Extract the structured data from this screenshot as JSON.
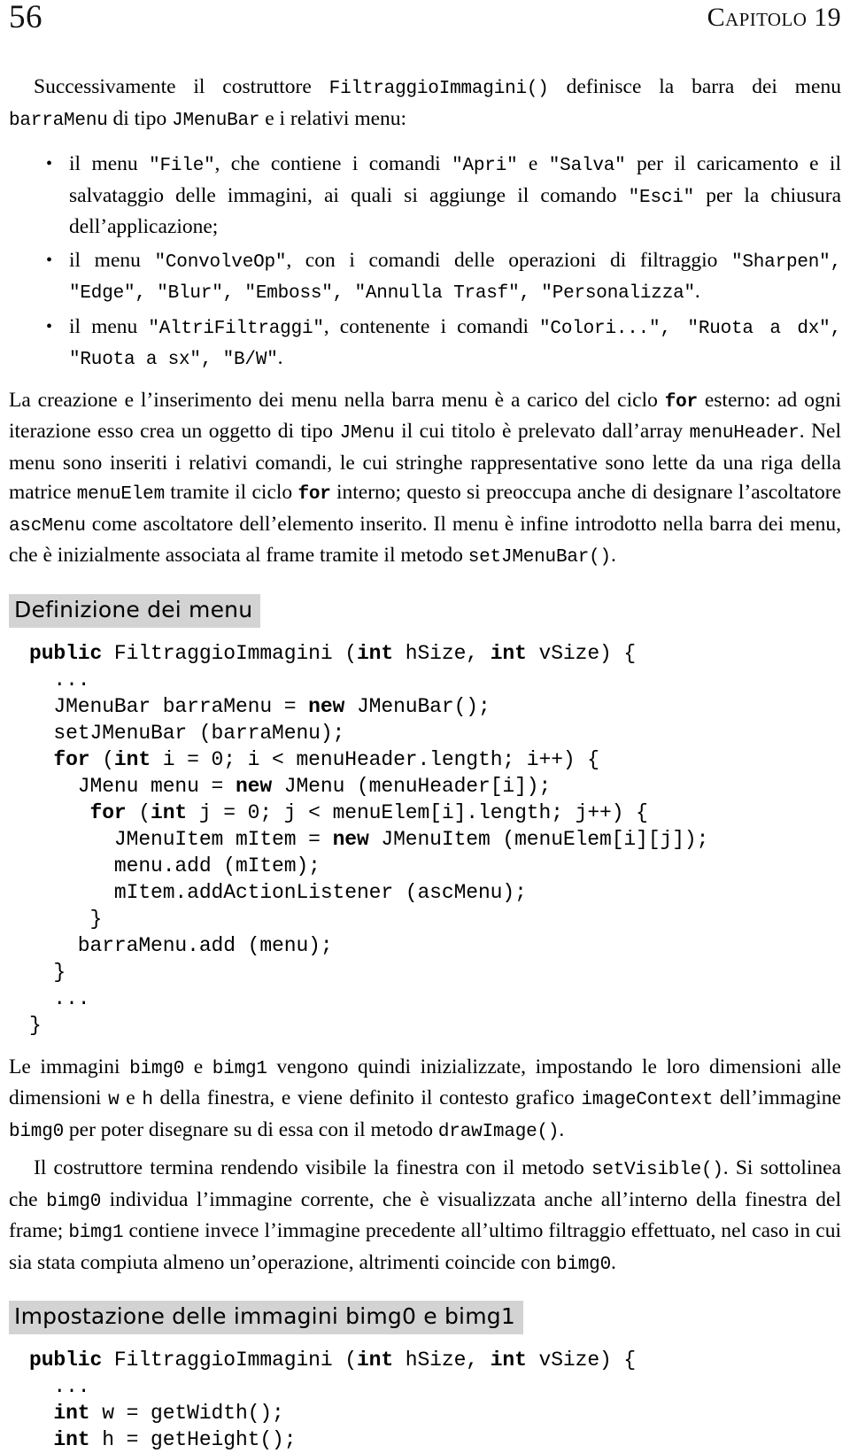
{
  "running_head": {
    "folio": "56",
    "chapter": "Capitolo 19"
  },
  "intro_paragraph": {
    "seg1": "Successivamente il costruttore ",
    "code1": "FiltraggioImmagini()",
    "seg2": " definisce la barra dei menu ",
    "code2": "barraMenu",
    "seg3": " di tipo ",
    "code3": "JMenuBar",
    "seg4": " e i relativi menu:"
  },
  "bullets": [
    {
      "s1": "il menu ",
      "c1": "\"File\"",
      "s2": ", che contiene i comandi ",
      "c2": "\"Apri\"",
      "s3": " e ",
      "c3": "\"Salva\"",
      "s4": " per il caricamento e il salvataggio delle immagini, ai quali si aggiunge il comando ",
      "c4": "\"Esci\"",
      "s5": " per la chiusura dell’applicazione;"
    },
    {
      "s1": "il menu ",
      "c1": "\"ConvolveOp\"",
      "s2": ", con i comandi delle operazioni di filtraggio ",
      "c2": "\"Sharpen\", \"Edge\", \"Blur\", \"Emboss\", \"Annulla Trasf\", \"Personalizza\"",
      "s3": "."
    },
    {
      "s1": "il menu ",
      "c1": "\"AltriFiltraggi\"",
      "s2": ", contenente i comandi ",
      "c2": "\"Colori...\", \"Ruota a dx\", \"Ruota a sx\", \"B/W\"",
      "s3": "."
    }
  ],
  "paragraph_for": {
    "p1": "La creazione e l’inserimento dei menu nella barra menu è a carico del ciclo ",
    "c1": "for",
    "p2": " esterno: ad ogni iterazione esso crea un oggetto di tipo ",
    "c2": "JMenu",
    "p3": " il cui titolo è prelevato dall’array ",
    "c3": "menuHeader",
    "p4": ". Nel menu sono inseriti i relativi comandi, le cui stringhe rappresentative sono lette da una riga della matrice ",
    "c4": "menuElem",
    "p5": " tramite il ciclo ",
    "c5": "for",
    "p6": " interno; questo si preoccupa anche di designare l’ascoltatore ",
    "c6": "ascMenu",
    "p7": " come ascoltatore dell’elemento inserito. Il menu è infine introdotto nella barra dei menu, che è inizialmente associata al frame tramite il metodo ",
    "c7": "setJMenuBar()",
    "p8": "."
  },
  "section_menu": {
    "heading": "Definizione dei menu",
    "code_lines": [
      {
        "indent": 0,
        "parts": [
          {
            "t": "public",
            "b": true
          },
          {
            "t": " FiltraggioImmagini (",
            "b": false
          },
          {
            "t": "int",
            "b": true
          },
          {
            "t": " hSize, ",
            "b": false
          },
          {
            "t": "int",
            "b": true
          },
          {
            "t": " vSize) {",
            "b": false
          }
        ]
      },
      {
        "indent": 0,
        "parts": [
          {
            "t": "  ...",
            "b": false
          }
        ]
      },
      {
        "indent": 0,
        "parts": [
          {
            "t": "  JMenuBar barraMenu = ",
            "b": false
          },
          {
            "t": "new",
            "b": true
          },
          {
            "t": " JMenuBar();",
            "b": false
          }
        ]
      },
      {
        "indent": 0,
        "parts": [
          {
            "t": "  setJMenuBar (barraMenu);",
            "b": false
          }
        ]
      },
      {
        "indent": 0,
        "parts": [
          {
            "t": "  ",
            "b": false
          },
          {
            "t": "for",
            "b": true
          },
          {
            "t": " (",
            "b": false
          },
          {
            "t": "int",
            "b": true
          },
          {
            "t": " i = 0; i < menuHeader.length; i++) {",
            "b": false
          }
        ]
      },
      {
        "indent": 0,
        "parts": [
          {
            "t": "    JMenu menu = ",
            "b": false
          },
          {
            "t": "new",
            "b": true
          },
          {
            "t": " JMenu (menuHeader[i]);",
            "b": false
          }
        ]
      },
      {
        "indent": 0,
        "parts": [
          {
            "t": "     ",
            "b": false
          },
          {
            "t": "for",
            "b": true
          },
          {
            "t": " (",
            "b": false
          },
          {
            "t": "int",
            "b": true
          },
          {
            "t": " j = 0; j < menuElem[i].length; j++) {",
            "b": false
          }
        ]
      },
      {
        "indent": 0,
        "parts": [
          {
            "t": "       JMenuItem mItem = ",
            "b": false
          },
          {
            "t": "new",
            "b": true
          },
          {
            "t": " JMenuItem (menuElem[i][j]);",
            "b": false
          }
        ]
      },
      {
        "indent": 0,
        "parts": [
          {
            "t": "       menu.add (mItem);",
            "b": false
          }
        ]
      },
      {
        "indent": 0,
        "parts": [
          {
            "t": "       mItem.addActionListener (ascMenu);",
            "b": false
          }
        ]
      },
      {
        "indent": 0,
        "parts": [
          {
            "t": "     }",
            "b": false
          }
        ]
      },
      {
        "indent": 0,
        "parts": [
          {
            "t": "    barraMenu.add (menu);",
            "b": false
          }
        ]
      },
      {
        "indent": 0,
        "parts": [
          {
            "t": "  }",
            "b": false
          }
        ]
      },
      {
        "indent": 0,
        "parts": [
          {
            "t": "  ...",
            "b": false
          }
        ]
      },
      {
        "indent": 0,
        "parts": [
          {
            "t": "}",
            "b": false
          }
        ]
      }
    ]
  },
  "paragraph_bimg": {
    "p1": "Le immagini ",
    "c1": "bimg0",
    "p2": " e ",
    "c2": "bimg1",
    "p3": " vengono quindi inizializzate, impostando le loro dimensioni alle dimensioni ",
    "c3": "w",
    "p4": " e ",
    "c4": "h",
    "p5": " della finestra, e viene definito il contesto grafico ",
    "c5": "imageContext",
    "p6": " dell’immagine ",
    "c6": "bimg0",
    "p7": " per poter disegnare su di essa con il metodo ",
    "c7": "drawImage()",
    "p8": "."
  },
  "paragraph_setvisible": {
    "p1": "Il costruttore termina rendendo visibile la finestra con il metodo ",
    "c1": "setVisible()",
    "p2": ". Si sottolinea che ",
    "c2": "bimg0",
    "p3": " individua l’immagine corrente, che è visualizzata anche all’interno della finestra del frame; ",
    "c3": "bimg1",
    "p4": " contiene invece l’immagine precedente all’ultimo filtraggio effettuato, nel caso in cui sia stata compiuta almeno un’operazione, altrimenti coincide con ",
    "c4": "bimg0",
    "p5": "."
  },
  "section_images": {
    "heading": "Impostazione delle immagini bimg0 e bimg1",
    "code_lines": [
      {
        "parts": [
          {
            "t": "public",
            "b": true
          },
          {
            "t": " FiltraggioImmagini (",
            "b": false
          },
          {
            "t": "int",
            "b": true
          },
          {
            "t": " hSize, ",
            "b": false
          },
          {
            "t": "int",
            "b": true
          },
          {
            "t": " vSize) {",
            "b": false
          }
        ]
      },
      {
        "parts": [
          {
            "t": "  ...",
            "b": false
          }
        ]
      },
      {
        "parts": [
          {
            "t": "  ",
            "b": false
          },
          {
            "t": "int",
            "b": true
          },
          {
            "t": " w = getWidth();",
            "b": false
          }
        ]
      },
      {
        "parts": [
          {
            "t": "  ",
            "b": false
          },
          {
            "t": "int",
            "b": true
          },
          {
            "t": " h = getHeight();",
            "b": false
          }
        ]
      }
    ]
  },
  "colors": {
    "heading_background": "#d3d3d3",
    "text": "#000000",
    "page_background": "#ffffff"
  }
}
